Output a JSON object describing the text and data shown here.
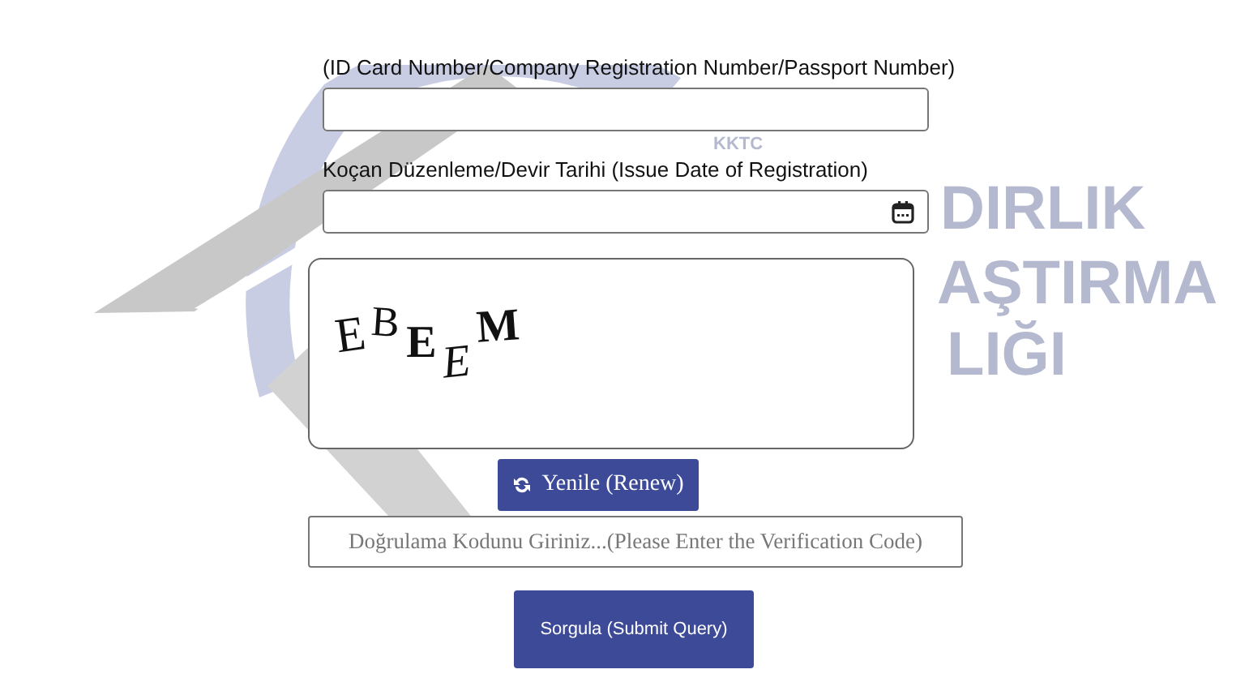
{
  "logo": {
    "texts": [
      "KKTC",
      "DIRLIK",
      "AŞTIRMA",
      "LIĞI"
    ]
  },
  "form": {
    "id_label": "(ID Card Number/Company Registration Number/Passport Number)",
    "date_label": "Koçan Düzenleme/Devir Tarihi (Issue Date of Registration)",
    "captcha_letters": [
      "E",
      "B",
      "E",
      "E",
      "M"
    ],
    "renew_button": "Yenile (Renew)",
    "code_field": {
      "placeholder": "Doğrulama Kodunu Giriniz...(Please Enter the Verification Code)"
    },
    "submit_button": "Sorgula (Submit Query)"
  }
}
